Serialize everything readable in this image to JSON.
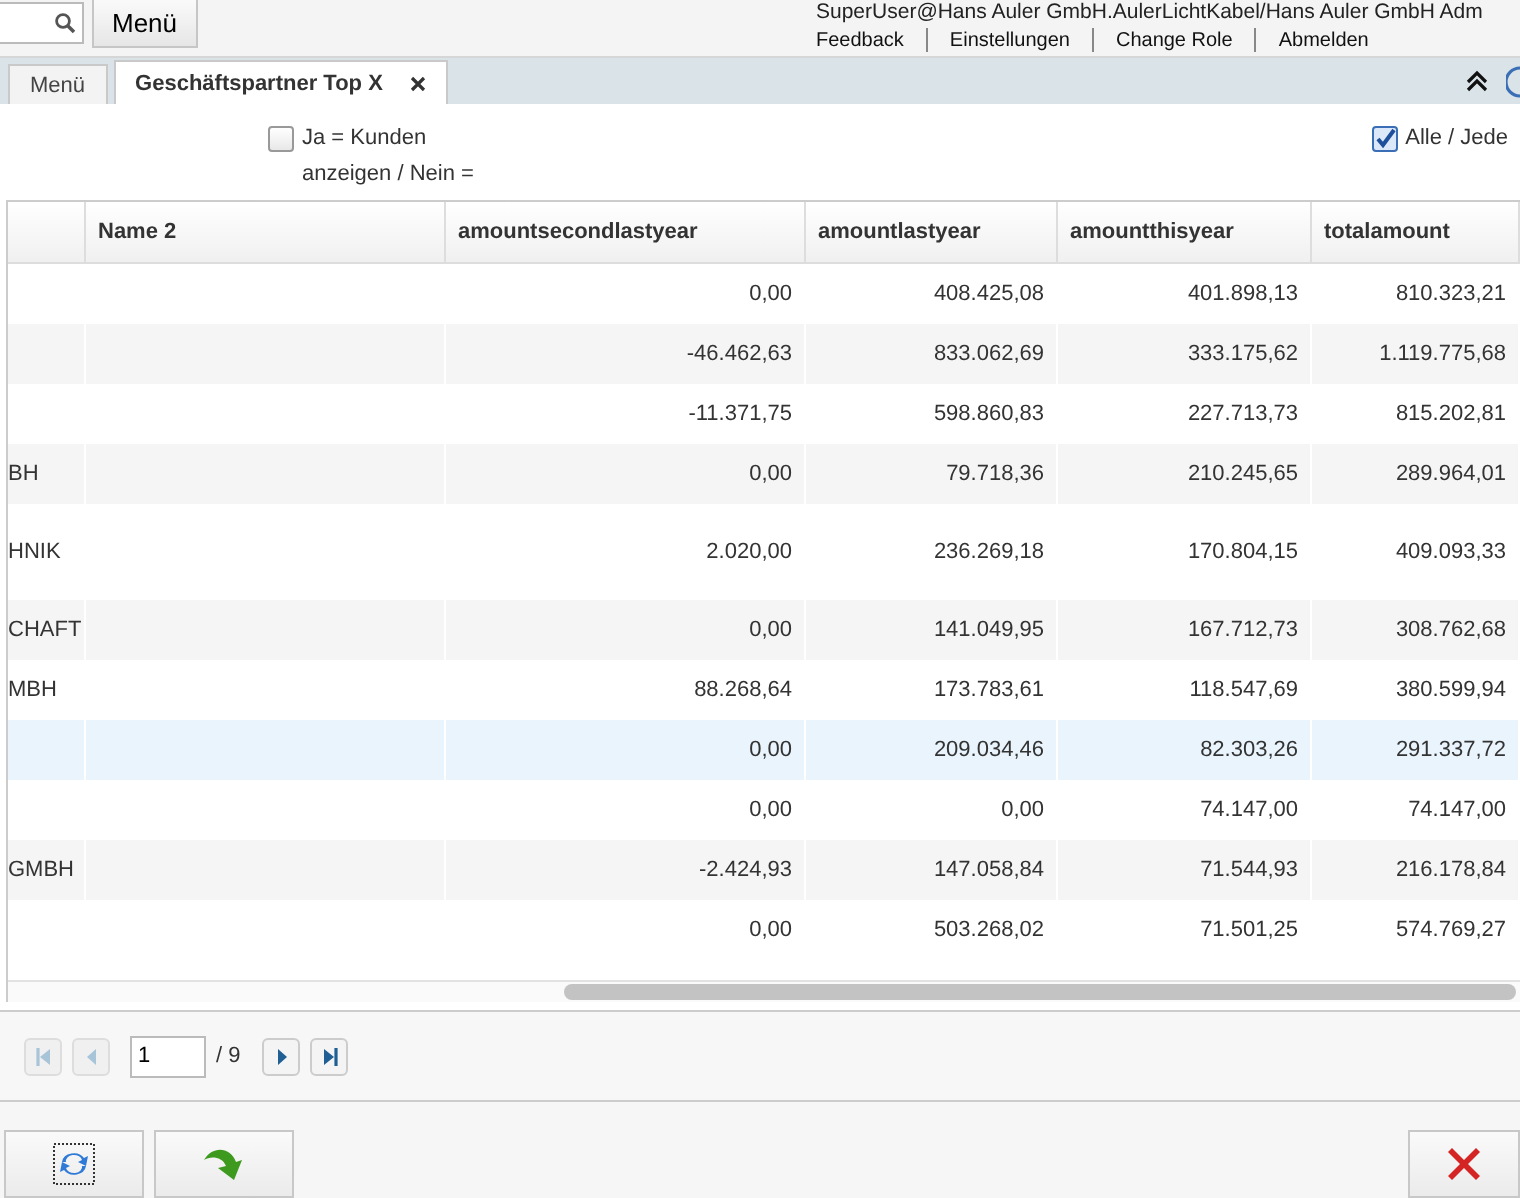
{
  "header": {
    "menu_button": "Menü",
    "user": "SuperUser@Hans Auler GmbH.AulerLichtKabel/Hans Auler GmbH Adm",
    "links": [
      "Feedback",
      "Einstellungen",
      "Change Role",
      "Abmelden"
    ]
  },
  "tabs": [
    {
      "label": "Menü",
      "selected": false,
      "closable": false
    },
    {
      "label": "Geschäftspartner Top X",
      "selected": true,
      "closable": true
    }
  ],
  "filters": [
    {
      "label": "Ja = Kunden anzeigen / Nein =",
      "checked": false
    },
    {
      "label": "Alle / Jede",
      "checked": true
    }
  ],
  "table": {
    "columns": [
      "",
      "Name 2",
      "amountsecondlastyear",
      "amountlastyear",
      "amountthisyear",
      "totalamount"
    ],
    "rows": [
      {
        "selected": false,
        "cells": [
          "",
          "",
          "0,00",
          "408.425,08",
          "401.898,13",
          "810.323,21"
        ]
      },
      {
        "selected": false,
        "cells": [
          "",
          "",
          "-46.462,63",
          "833.062,69",
          "333.175,62",
          "1.119.775,68"
        ]
      },
      {
        "selected": false,
        "cells": [
          "",
          "",
          "-11.371,75",
          "598.860,83",
          "227.713,73",
          "815.202,81"
        ]
      },
      {
        "selected": false,
        "cells": [
          "BH",
          "",
          "0,00",
          "79.718,36",
          "210.245,65",
          "289.964,01"
        ]
      },
      {
        "selected": false,
        "cells": [
          "HNIK",
          "",
          "2.020,00",
          "236.269,18",
          "170.804,15",
          "409.093,33"
        ]
      },
      {
        "selected": false,
        "cells": [
          "CHAFT",
          "",
          "0,00",
          "141.049,95",
          "167.712,73",
          "308.762,68"
        ]
      },
      {
        "selected": false,
        "cells": [
          "MBH",
          "",
          "88.268,64",
          "173.783,61",
          "118.547,69",
          "380.599,94"
        ]
      },
      {
        "selected": true,
        "cells": [
          "",
          "",
          "0,00",
          "209.034,46",
          "82.303,26",
          "291.337,72"
        ]
      },
      {
        "selected": false,
        "cells": [
          "",
          "",
          "0,00",
          "0,00",
          "74.147,00",
          "74.147,00"
        ]
      },
      {
        "selected": false,
        "cells": [
          "GMBH",
          "",
          "-2.424,93",
          "147.058,84",
          "71.544,93",
          "216.178,84"
        ]
      },
      {
        "selected": false,
        "cells": [
          "",
          "",
          "0,00",
          "503.268,02",
          "71.501,25",
          "574.769,27"
        ]
      }
    ]
  },
  "pager": {
    "page": "1",
    "total": "/ 9",
    "buttons": [
      {
        "kind": "first",
        "disabled": true
      },
      {
        "kind": "prev",
        "disabled": true
      },
      {
        "kind": "next",
        "disabled": false
      },
      {
        "kind": "last",
        "disabled": false
      }
    ]
  }
}
